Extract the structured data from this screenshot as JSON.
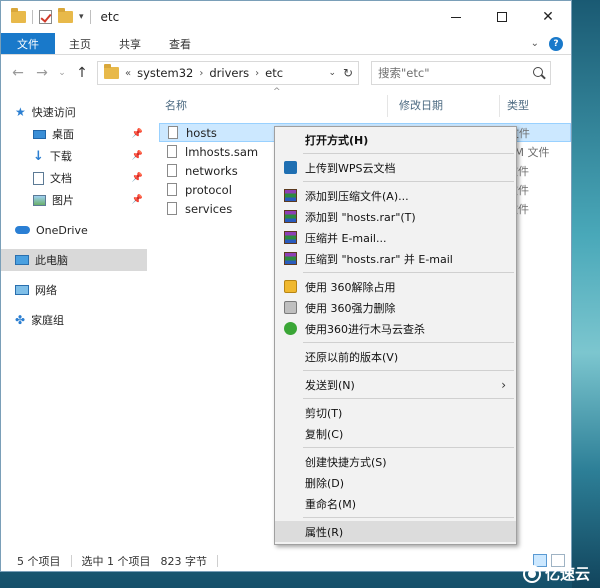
{
  "window": {
    "title": "etc",
    "ribbon_tabs": [
      "文件",
      "主页",
      "共享",
      "查看"
    ],
    "help_symbol": "?"
  },
  "address": {
    "overflow": "«",
    "crumbs": [
      "system32",
      "drivers",
      "etc"
    ],
    "search_placeholder": "搜索\"etc\""
  },
  "nav": {
    "quick_access": "快速访问",
    "quick_items": [
      {
        "label": "桌面",
        "icon": "desktop-icon"
      },
      {
        "label": "下载",
        "icon": "download-icon"
      },
      {
        "label": "文档",
        "icon": "documents-icon"
      },
      {
        "label": "图片",
        "icon": "pictures-icon"
      }
    ],
    "onedrive": "OneDrive",
    "this_pc": "此电脑",
    "network": "网络",
    "homegroup": "家庭组"
  },
  "columns": {
    "name": "名称",
    "date": "修改日期",
    "type": "类型"
  },
  "files": [
    {
      "name": "hosts",
      "type": "文件",
      "selected": true
    },
    {
      "name": "lmhosts.sam",
      "type": "AM 文件",
      "selected": false
    },
    {
      "name": "networks",
      "type": "文件",
      "selected": false
    },
    {
      "name": "protocol",
      "type": "文件",
      "selected": false
    },
    {
      "name": "services",
      "type": "文件",
      "selected": false
    }
  ],
  "status": {
    "count": "5 个项目",
    "selection": "选中 1 个项目",
    "size": "823 字节"
  },
  "context_menu": {
    "open_with": "打开方式(H)",
    "upload_wps": "上传到WPS云文档",
    "add_archive": "添加到压缩文件(A)...",
    "add_hosts_rar": "添加到 \"hosts.rar\"(T)",
    "compress_email": "压缩并 E-mail...",
    "compress_hosts_email": "压缩到 \"hosts.rar\" 并 E-mail",
    "unlock_360": "使用 360解除占用",
    "force_delete_360": "使用 360强力删除",
    "trojan_scan_360": "使用360进行木马云查杀",
    "restore_versions": "还原以前的版本(V)",
    "send_to": "发送到(N)",
    "cut": "剪切(T)",
    "copy": "复制(C)",
    "create_shortcut": "创建快捷方式(S)",
    "delete": "删除(D)",
    "rename": "重命名(M)",
    "properties": "属性(R)"
  },
  "watermark": "亿速云",
  "colors": {
    "accent": "#1979ca",
    "selection": "#cce8ff",
    "menu_bg": "#f2f2f2"
  }
}
